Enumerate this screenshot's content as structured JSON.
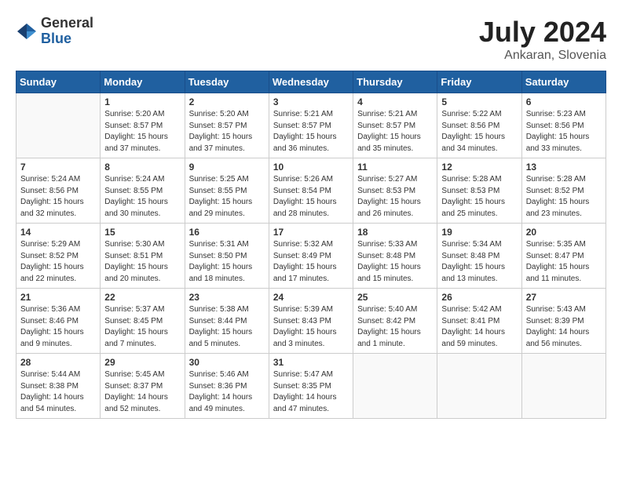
{
  "header": {
    "logo_general": "General",
    "logo_blue": "Blue",
    "month_year": "July 2024",
    "location": "Ankaran, Slovenia"
  },
  "weekdays": [
    "Sunday",
    "Monday",
    "Tuesday",
    "Wednesday",
    "Thursday",
    "Friday",
    "Saturday"
  ],
  "weeks": [
    [
      {
        "day": "",
        "info": ""
      },
      {
        "day": "1",
        "info": "Sunrise: 5:20 AM\nSunset: 8:57 PM\nDaylight: 15 hours\nand 37 minutes."
      },
      {
        "day": "2",
        "info": "Sunrise: 5:20 AM\nSunset: 8:57 PM\nDaylight: 15 hours\nand 37 minutes."
      },
      {
        "day": "3",
        "info": "Sunrise: 5:21 AM\nSunset: 8:57 PM\nDaylight: 15 hours\nand 36 minutes."
      },
      {
        "day": "4",
        "info": "Sunrise: 5:21 AM\nSunset: 8:57 PM\nDaylight: 15 hours\nand 35 minutes."
      },
      {
        "day": "5",
        "info": "Sunrise: 5:22 AM\nSunset: 8:56 PM\nDaylight: 15 hours\nand 34 minutes."
      },
      {
        "day": "6",
        "info": "Sunrise: 5:23 AM\nSunset: 8:56 PM\nDaylight: 15 hours\nand 33 minutes."
      }
    ],
    [
      {
        "day": "7",
        "info": "Sunrise: 5:24 AM\nSunset: 8:56 PM\nDaylight: 15 hours\nand 32 minutes."
      },
      {
        "day": "8",
        "info": "Sunrise: 5:24 AM\nSunset: 8:55 PM\nDaylight: 15 hours\nand 30 minutes."
      },
      {
        "day": "9",
        "info": "Sunrise: 5:25 AM\nSunset: 8:55 PM\nDaylight: 15 hours\nand 29 minutes."
      },
      {
        "day": "10",
        "info": "Sunrise: 5:26 AM\nSunset: 8:54 PM\nDaylight: 15 hours\nand 28 minutes."
      },
      {
        "day": "11",
        "info": "Sunrise: 5:27 AM\nSunset: 8:53 PM\nDaylight: 15 hours\nand 26 minutes."
      },
      {
        "day": "12",
        "info": "Sunrise: 5:28 AM\nSunset: 8:53 PM\nDaylight: 15 hours\nand 25 minutes."
      },
      {
        "day": "13",
        "info": "Sunrise: 5:28 AM\nSunset: 8:52 PM\nDaylight: 15 hours\nand 23 minutes."
      }
    ],
    [
      {
        "day": "14",
        "info": "Sunrise: 5:29 AM\nSunset: 8:52 PM\nDaylight: 15 hours\nand 22 minutes."
      },
      {
        "day": "15",
        "info": "Sunrise: 5:30 AM\nSunset: 8:51 PM\nDaylight: 15 hours\nand 20 minutes."
      },
      {
        "day": "16",
        "info": "Sunrise: 5:31 AM\nSunset: 8:50 PM\nDaylight: 15 hours\nand 18 minutes."
      },
      {
        "day": "17",
        "info": "Sunrise: 5:32 AM\nSunset: 8:49 PM\nDaylight: 15 hours\nand 17 minutes."
      },
      {
        "day": "18",
        "info": "Sunrise: 5:33 AM\nSunset: 8:48 PM\nDaylight: 15 hours\nand 15 minutes."
      },
      {
        "day": "19",
        "info": "Sunrise: 5:34 AM\nSunset: 8:48 PM\nDaylight: 15 hours\nand 13 minutes."
      },
      {
        "day": "20",
        "info": "Sunrise: 5:35 AM\nSunset: 8:47 PM\nDaylight: 15 hours\nand 11 minutes."
      }
    ],
    [
      {
        "day": "21",
        "info": "Sunrise: 5:36 AM\nSunset: 8:46 PM\nDaylight: 15 hours\nand 9 minutes."
      },
      {
        "day": "22",
        "info": "Sunrise: 5:37 AM\nSunset: 8:45 PM\nDaylight: 15 hours\nand 7 minutes."
      },
      {
        "day": "23",
        "info": "Sunrise: 5:38 AM\nSunset: 8:44 PM\nDaylight: 15 hours\nand 5 minutes."
      },
      {
        "day": "24",
        "info": "Sunrise: 5:39 AM\nSunset: 8:43 PM\nDaylight: 15 hours\nand 3 minutes."
      },
      {
        "day": "25",
        "info": "Sunrise: 5:40 AM\nSunset: 8:42 PM\nDaylight: 15 hours\nand 1 minute."
      },
      {
        "day": "26",
        "info": "Sunrise: 5:42 AM\nSunset: 8:41 PM\nDaylight: 14 hours\nand 59 minutes."
      },
      {
        "day": "27",
        "info": "Sunrise: 5:43 AM\nSunset: 8:39 PM\nDaylight: 14 hours\nand 56 minutes."
      }
    ],
    [
      {
        "day": "28",
        "info": "Sunrise: 5:44 AM\nSunset: 8:38 PM\nDaylight: 14 hours\nand 54 minutes."
      },
      {
        "day": "29",
        "info": "Sunrise: 5:45 AM\nSunset: 8:37 PM\nDaylight: 14 hours\nand 52 minutes."
      },
      {
        "day": "30",
        "info": "Sunrise: 5:46 AM\nSunset: 8:36 PM\nDaylight: 14 hours\nand 49 minutes."
      },
      {
        "day": "31",
        "info": "Sunrise: 5:47 AM\nSunset: 8:35 PM\nDaylight: 14 hours\nand 47 minutes."
      },
      {
        "day": "",
        "info": ""
      },
      {
        "day": "",
        "info": ""
      },
      {
        "day": "",
        "info": ""
      }
    ]
  ]
}
